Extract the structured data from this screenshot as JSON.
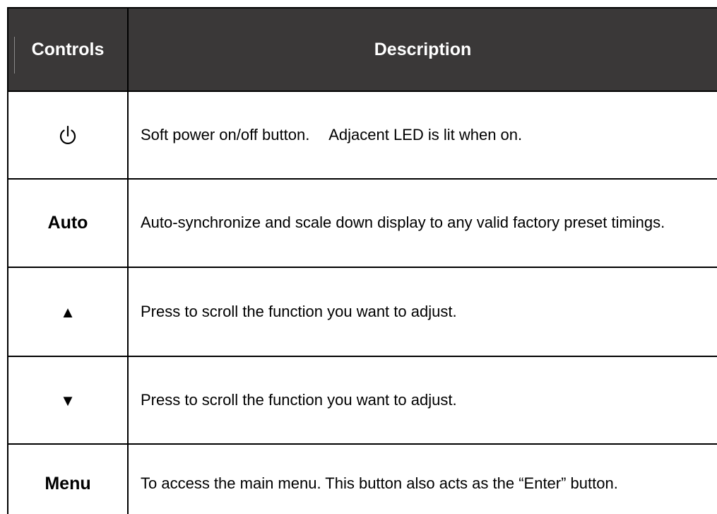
{
  "table": {
    "header": {
      "controls": "Controls",
      "description": "Description"
    },
    "rows": [
      {
        "control": "",
        "control_icon": "power-icon",
        "description": "Soft power on/off button.  Adjacent LED is lit when on."
      },
      {
        "control": "Auto",
        "description": "Auto-synchronize and scale down display to any valid factory preset timings."
      },
      {
        "control": "▲",
        "control_icon": "up-arrow-icon",
        "description": "Press to scroll the function you want to adjust."
      },
      {
        "control": "▼",
        "control_icon": "down-arrow-icon",
        "description": "Press to scroll the function you want to adjust."
      },
      {
        "control": "Menu",
        "description": "To access the main menu. This button also acts as the “Enter” button."
      }
    ]
  },
  "colors": {
    "header_background": "#3a3838",
    "header_text": "#ffffff",
    "border": "#000000"
  }
}
